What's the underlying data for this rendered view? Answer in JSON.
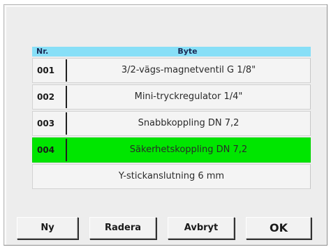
{
  "table": {
    "headers": {
      "nr": "Nr.",
      "byte": "Byte"
    },
    "rows": [
      {
        "nr": "001",
        "label": "3/2-vägs-magnetventil G 1/8\"",
        "selected": false
      },
      {
        "nr": "002",
        "label": "Mini-tryckregulator 1/4\"",
        "selected": false
      },
      {
        "nr": "003",
        "label": "Snabbkoppling DN 7,2",
        "selected": false
      },
      {
        "nr": "004",
        "label": "Säkerhetskoppling DN 7,2",
        "selected": true
      },
      {
        "nr": "",
        "label": "Y-stickanslutning 6 mm",
        "selected": false
      }
    ]
  },
  "buttons": {
    "new": "Ny",
    "delete": "Radera",
    "cancel": "Avbryt",
    "ok": "OK"
  },
  "colors": {
    "header_bg": "#87dff7",
    "selected_row": "#00e600",
    "row_bg": "#f4f4f4",
    "window_bg": "#ededed"
  }
}
